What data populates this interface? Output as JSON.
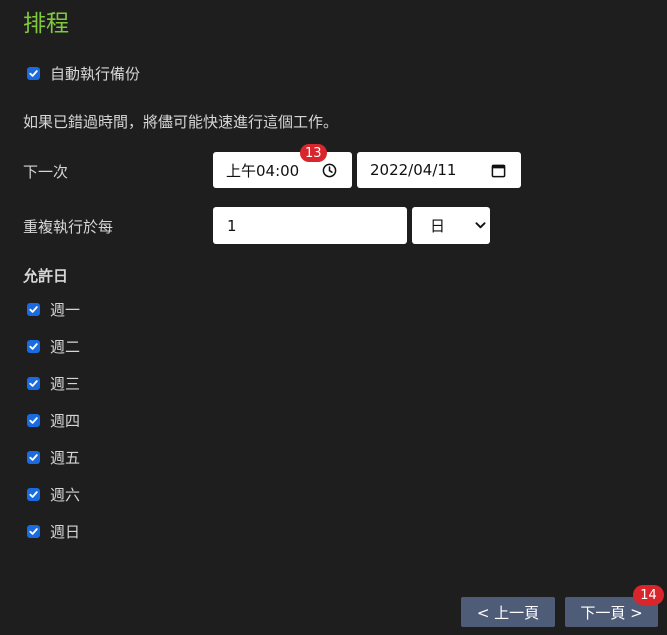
{
  "page": {
    "title": "排程"
  },
  "auto_backup": {
    "label": "自動執行備份",
    "checked": true
  },
  "note": "如果已錯過時間，將儘可能快速進行這個工作。",
  "next_run": {
    "label": "下一次",
    "time_value": "上午04:00",
    "date_value": "2022/04/11",
    "time_badge": "13"
  },
  "repeat": {
    "label": "重複執行於每",
    "count": "1",
    "unit": "日"
  },
  "allowed_days": {
    "heading": "允許日",
    "days": [
      {
        "label": "週一",
        "checked": true
      },
      {
        "label": "週二",
        "checked": true
      },
      {
        "label": "週三",
        "checked": true
      },
      {
        "label": "週四",
        "checked": true
      },
      {
        "label": "週五",
        "checked": true
      },
      {
        "label": "週六",
        "checked": true
      },
      {
        "label": "週日",
        "checked": true
      }
    ]
  },
  "nav": {
    "prev_label": "< 上一頁",
    "next_label": "下一頁 >",
    "next_badge": "14"
  },
  "colors": {
    "title": "#7fc93d",
    "checkbox": "#1a6be0",
    "button": "#4f5c78",
    "badge": "#d9262c"
  }
}
